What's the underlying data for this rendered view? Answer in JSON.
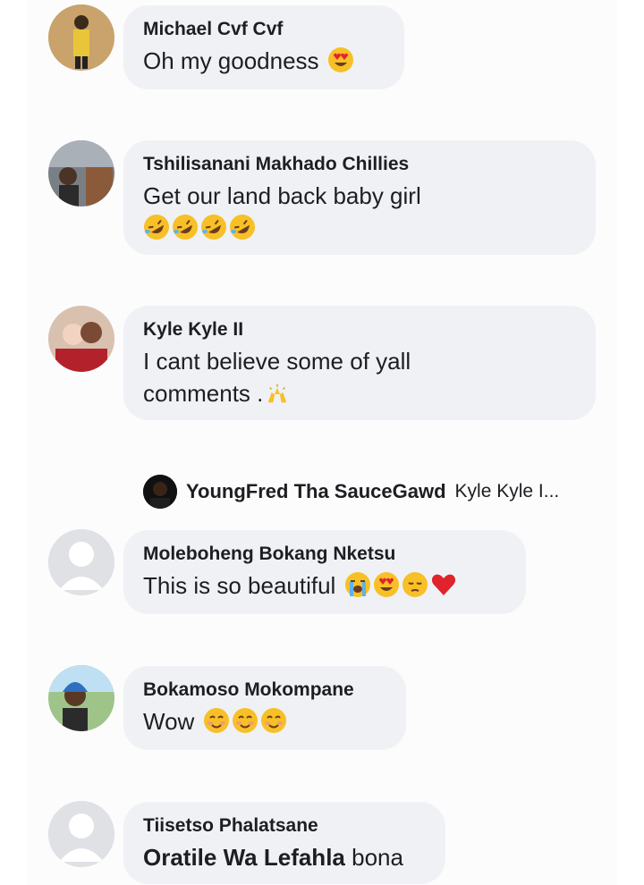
{
  "comments": [
    {
      "name": "Michael Cvf Cvf",
      "text": "Oh my goodness",
      "emojis": [
        "heart-eyes"
      ]
    },
    {
      "name": "Tshilisanani Makhado Chillies",
      "text": "Get our land back baby girl",
      "emojis": [
        "rofl",
        "rofl",
        "rofl",
        "rofl"
      ]
    },
    {
      "name": "Kyle Kyle II",
      "text_line1": "I cant believe some of yall",
      "text_line2": "comments .",
      "emojis": [
        "raised-hands"
      ]
    },
    {
      "name": "Moleboheng Bokang Nketsu",
      "text": "This is so beautiful",
      "emojis": [
        "loudly-crying",
        "heart-eyes",
        "pensive",
        "red-heart"
      ]
    },
    {
      "name": "Bokamoso Mokompane",
      "text": "Wow",
      "emojis": [
        "smiling-blush",
        "smiling-blush",
        "smiling-blush"
      ]
    },
    {
      "name": "Tiisetso Phalatsane",
      "mention": "Oratile Wa Lefahla",
      "text": "bona"
    }
  ],
  "reply": {
    "name": "YoungFred Tha SauceGawd",
    "preview": "Kyle Kyle I..."
  },
  "colors": {
    "bubble": "#f0f1f4",
    "text": "#1c1e21",
    "emoji_yellow": "#f7c026",
    "heart_red": "#e0242d"
  }
}
